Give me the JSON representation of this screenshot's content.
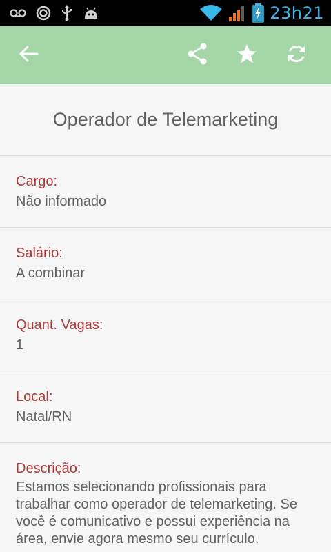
{
  "status_bar": {
    "time": "23h21",
    "icons": [
      "voicemail-icon",
      "app-icon",
      "usb-icon",
      "android-debug-icon",
      "wifi-icon",
      "signal-icon",
      "battery-charging-icon"
    ],
    "accent_color": "#39b7e8"
  },
  "app_bar": {
    "background_color": "#a5d6a7",
    "actions": [
      "back-arrow-icon",
      "share-icon",
      "star-icon",
      "refresh-icon"
    ]
  },
  "job": {
    "title": "Operador de Telemarketing",
    "fields": {
      "cargo": {
        "label": "Cargo:",
        "value": "Não informado"
      },
      "salario": {
        "label": "Salário:",
        "value": "A combinar"
      },
      "vagas": {
        "label": "Quant. Vagas:",
        "value": "1"
      },
      "local": {
        "label": "Local:",
        "value": "Natal/RN"
      },
      "descricao": {
        "label": "Descrição:",
        "value": "Estamos selecionando profissionais para trabalhar como operador de telemarketing. Se você é comunicativo e possui experiência na área, envie agora mesmo seu currículo."
      }
    },
    "label_color": "#b03a3a"
  }
}
